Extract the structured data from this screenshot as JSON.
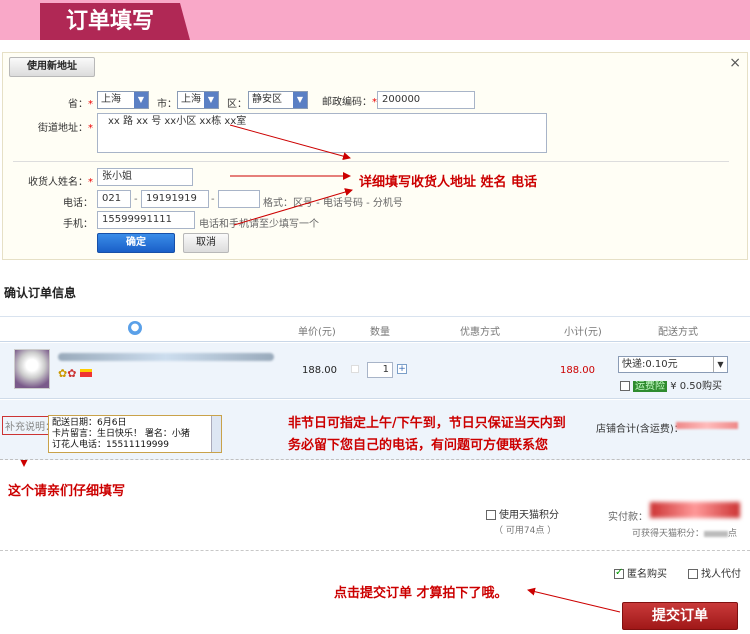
{
  "header": {
    "title": "订单填写"
  },
  "address": {
    "new_address_btn": "使用新地址",
    "province_label": "省：",
    "province": "上海",
    "city_label": "市：",
    "city": "上海",
    "district_label": "区：",
    "district": "静安区",
    "zip_label": "邮政编码：",
    "zip": "200000",
    "street_label": "街道地址：",
    "street": "xx 路 xx 号  xx小区 xx栋 xx室",
    "name_label": "收货人姓名：",
    "name": "张小姐",
    "phone_label": "电话：",
    "phone_area": "021",
    "phone_num": "19191919",
    "phone_ext": "",
    "phone_format": "格式：区号 - 电话号码 - 分机号",
    "mobile_label": "手机：",
    "mobile": "15599991111",
    "mobile_hint": "电话和手机请至少填写一个",
    "confirm_btn": "确定",
    "cancel_btn": "取消",
    "annotation": "详细填写收货人地址 姓名 电话"
  },
  "order": {
    "section_title": "确认订单信息",
    "columns": [
      "单价(元)",
      "数量",
      "优惠方式",
      "小计(元)",
      "配送方式"
    ],
    "item": {
      "price": "188.00",
      "qty": "1",
      "subtotal": "188.00",
      "shipping": "快递:0.10元",
      "freight_insurance": "运费险",
      "freight_insurance_price": "¥ 0.50购买"
    },
    "memo_label": "补充说明：",
    "memo_lines": [
      "配送日期：6月6日",
      "卡片留言：生日快乐！  署名：小猪",
      "订花人电话：15511119999"
    ],
    "memo_note1": "非节日可指定上午/下午到，节日只保证当天内到",
    "memo_note2": "务必留下您自己的电话，有问题可方便联系您",
    "memo_note3": "这个请亲们仔细填写",
    "store_total_label": "店铺合计(含运费)："
  },
  "summary": {
    "use_points": "使用天猫积分",
    "available_points": "（ 可用74点 ）",
    "pay_label": "实付款：",
    "earn_points_label": "可获得天猫积分：",
    "earn_points_suffix": "点",
    "anonymous": "匿名购买",
    "proxy": "找人代付",
    "submit_note": "点击提交订单  才算拍下了哦。",
    "submit_btn": "提交订单"
  },
  "colors": {
    "brand": "#b02855",
    "header_bg": "#f9a8c8",
    "annotation": "#c00000",
    "submit": "#b01c1c"
  }
}
